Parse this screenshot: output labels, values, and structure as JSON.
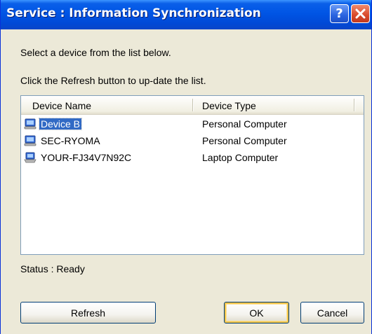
{
  "window": {
    "title": "Service : Information Synchronization",
    "help_glyph": "?"
  },
  "instructions": {
    "line1": "Select a device from the list below.",
    "line2": "Click the Refresh button to up-date the list."
  },
  "list": {
    "columns": [
      "Device Name",
      "Device Type"
    ],
    "rows": [
      {
        "name": "Device B",
        "type": "Personal Computer",
        "icon": "personal-computer-icon",
        "selected": true
      },
      {
        "name": "SEC-RYOMA",
        "type": "Personal Computer",
        "icon": "personal-computer-icon",
        "selected": false
      },
      {
        "name": "YOUR-FJ34V7N92C",
        "type": "Laptop Computer",
        "icon": "laptop-computer-icon",
        "selected": false
      }
    ]
  },
  "status": {
    "text": "Status : Ready"
  },
  "buttons": {
    "refresh": "Refresh",
    "ok": "OK",
    "cancel": "Cancel"
  },
  "colors": {
    "title_bar": "#0055e5",
    "selection": "#316ac5",
    "close_button": "#d8492a",
    "default_button_highlight": "#f0c44a"
  }
}
